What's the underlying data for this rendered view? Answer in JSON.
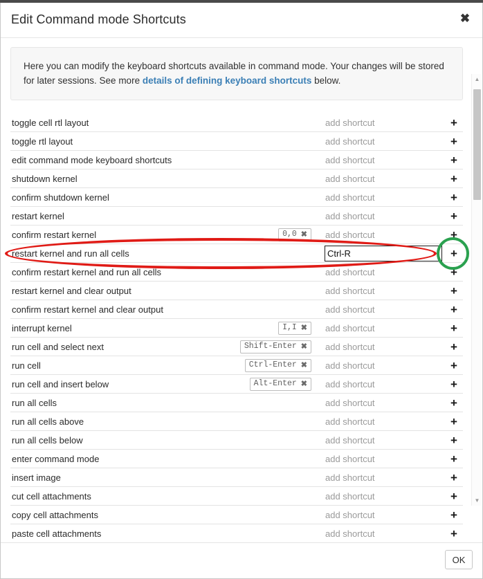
{
  "dialog": {
    "title": "Edit Command mode Shortcuts",
    "close_icon": "close-icon",
    "ok_label": "OK"
  },
  "info": {
    "text_before": "Here you can modify the keyboard shortcuts available in command mode. Your changes will be stored for later sessions. See more ",
    "link_text": "details of defining keyboard shortcuts",
    "text_after": " below."
  },
  "labels": {
    "add_shortcut": "add shortcut",
    "plus_icon": "+",
    "remove_icon": "✖"
  },
  "editing": {
    "input_value": "Ctrl-R",
    "input_placeholder": ""
  },
  "colors": {
    "annotation_ellipse": "#e01b16",
    "annotation_circle": "#2aa14f",
    "link": "#3b7fb5",
    "muted_text": "#9a9a9a"
  },
  "scrollbar": {
    "up_arrow": "▲",
    "down_arrow": "▼"
  },
  "rows": [
    {
      "label": "toggle cell rtl layout",
      "chips": [],
      "editing": false
    },
    {
      "label": "toggle rtl layout",
      "chips": [],
      "editing": false
    },
    {
      "label": "edit command mode keyboard shortcuts",
      "chips": [],
      "editing": false
    },
    {
      "label": "shutdown kernel",
      "chips": [],
      "editing": false
    },
    {
      "label": "confirm shutdown kernel",
      "chips": [],
      "editing": false
    },
    {
      "label": "restart kernel",
      "chips": [],
      "editing": false
    },
    {
      "label": "confirm restart kernel",
      "chips": [
        "0,0"
      ],
      "editing": false
    },
    {
      "label": "restart kernel and run all cells",
      "chips": [],
      "editing": true
    },
    {
      "label": "confirm restart kernel and run all cells",
      "chips": [],
      "editing": false
    },
    {
      "label": "restart kernel and clear output",
      "chips": [],
      "editing": false
    },
    {
      "label": "confirm restart kernel and clear output",
      "chips": [],
      "editing": false
    },
    {
      "label": "interrupt kernel",
      "chips": [
        "I,I"
      ],
      "editing": false
    },
    {
      "label": "run cell and select next",
      "chips": [
        "Shift-Enter"
      ],
      "editing": false
    },
    {
      "label": "run cell",
      "chips": [
        "Ctrl-Enter"
      ],
      "editing": false
    },
    {
      "label": "run cell and insert below",
      "chips": [
        "Alt-Enter"
      ],
      "editing": false
    },
    {
      "label": "run all cells",
      "chips": [],
      "editing": false
    },
    {
      "label": "run all cells above",
      "chips": [],
      "editing": false
    },
    {
      "label": "run all cells below",
      "chips": [],
      "editing": false
    },
    {
      "label": "enter command mode",
      "chips": [],
      "editing": false
    },
    {
      "label": "insert image",
      "chips": [],
      "editing": false
    },
    {
      "label": "cut cell attachments",
      "chips": [],
      "editing": false
    },
    {
      "label": "copy cell attachments",
      "chips": [],
      "editing": false
    },
    {
      "label": "paste cell attachments",
      "chips": [],
      "editing": false
    }
  ]
}
